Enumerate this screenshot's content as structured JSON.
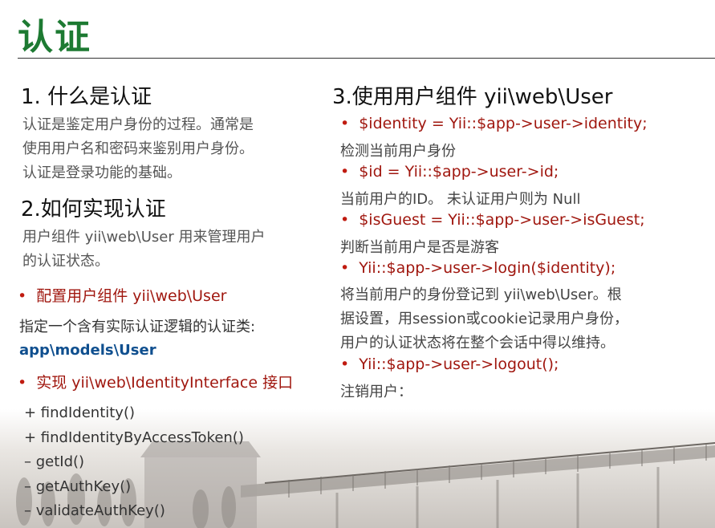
{
  "title": "认证",
  "left": {
    "s1_heading": "1. 什么是认证",
    "s1_lines": [
      "认证是鉴定用户身份的过程。通常是",
      "使用用户名和密码来鉴别用户身份。",
      "认证是登录功能的基础。"
    ],
    "s2_heading": "2.如何实现认证",
    "s2_lines": [
      "用户组件 yii\\web\\User 用来管理用户",
      "的认证状态。"
    ],
    "bullet1": "配置用户组件 yii\\web\\User",
    "config_line": "指定一个含有实际认证逻辑的认证类:",
    "config_class": "app\\models\\User",
    "bullet2": "实现 yii\\web\\IdentityInterface 接口",
    "methods": [
      "+ findIdentity()",
      "+ findIdentityByAccessToken()",
      "– getId()",
      "– getAuthKey()",
      "– validateAuthKey()"
    ]
  },
  "right": {
    "heading": "3.使用用户组件 yii\\web\\User",
    "b1": "$identity = Yii::$app->user->identity;",
    "b1_desc": "检测当前用户身份",
    "b2": "$id = Yii::$app->user->id;",
    "b2_desc": "当前用户的ID。 未认证用户则为 Null",
    "b3": "$isGuest = Yii::$app->user->isGuest;",
    "b3_desc": "判断当前用户是否是游客",
    "b4": "Yii::$app->user->login($identity);",
    "b4_desc": [
      "将当前用户的身份登记到 yii\\web\\User。根",
      "据设置，用session或cookie记录用户身份，",
      "用户的认证状态将在整个会话中得以维持。"
    ],
    "b5": "Yii::$app->user->logout();",
    "b5_desc": "注销用户："
  }
}
